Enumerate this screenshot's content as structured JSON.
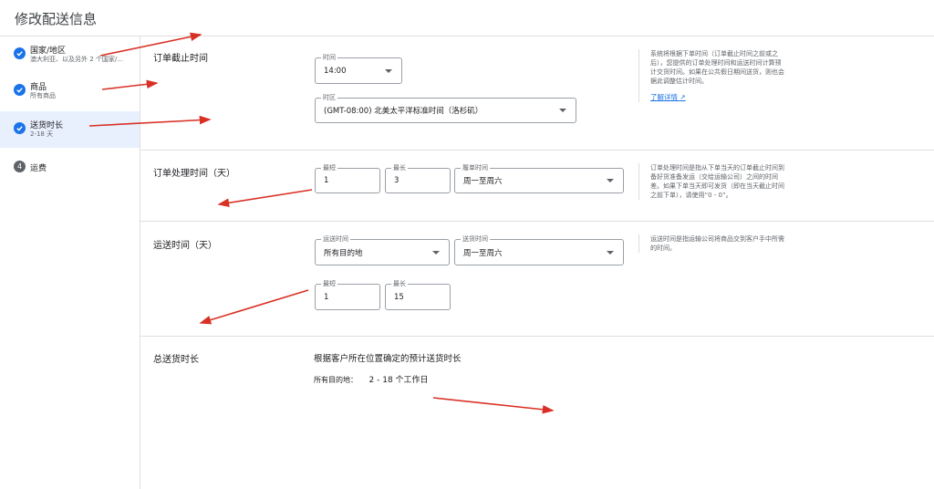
{
  "header": {
    "title": "修改配送信息"
  },
  "sidebar": {
    "steps": [
      {
        "label": "国家/地区",
        "sub": "澳大利亚、以及另外 2 个国家/..."
      },
      {
        "label": "商品",
        "sub": "所有商品"
      },
      {
        "label": "送货时长",
        "sub": "2-18 天"
      },
      {
        "number": "4",
        "label": "运费"
      }
    ]
  },
  "cutoff": {
    "title": "订单截止时间",
    "time_label": "时间",
    "time_value": "14:00",
    "zone_label": "时区",
    "zone_value": "(GMT-08:00) 北美太平洋标准时间（洛杉矶）",
    "note": "系统将根据下单时间（订单截止时间之前或之后），您提供的订单处理时间和运送时间计算预计交货时间。如果在公共假日期间送货，则也会据此调整估计时间。",
    "learn_more": "了解详情"
  },
  "handling": {
    "title": "订单处理时间（天）",
    "min_label": "最短",
    "min_value": "1",
    "max_label": "最长",
    "max_value": "3",
    "days_label": "履单时间",
    "days_value": "周一至周六",
    "note": "订单处理时间是指从下单当天的订单截止时间到备好货准备发运（交给运输公司）之间的时间差。如果下单当天即可发货（即在当天截止时间之前下单），请使用“0 - 0”。"
  },
  "transit": {
    "title": "运送时间（天）",
    "dest_label": "运送时间",
    "dest_value": "所有目的地",
    "days_label": "送货时间",
    "days_value": "周一至周六",
    "min_label": "最短",
    "min_value": "1",
    "max_label": "最长",
    "max_value": "15",
    "note": "运送时间是指运输公司将商品交到客户手中所需的时间。"
  },
  "total": {
    "title": "总送货时长",
    "heading": "根据客户所在位置确定的预计送货时长",
    "row_label": "所有目的地：",
    "row_value": "2 - 18 个工作日"
  },
  "colors": {
    "accent": "#1a73e8",
    "annotation": "#d93025"
  }
}
